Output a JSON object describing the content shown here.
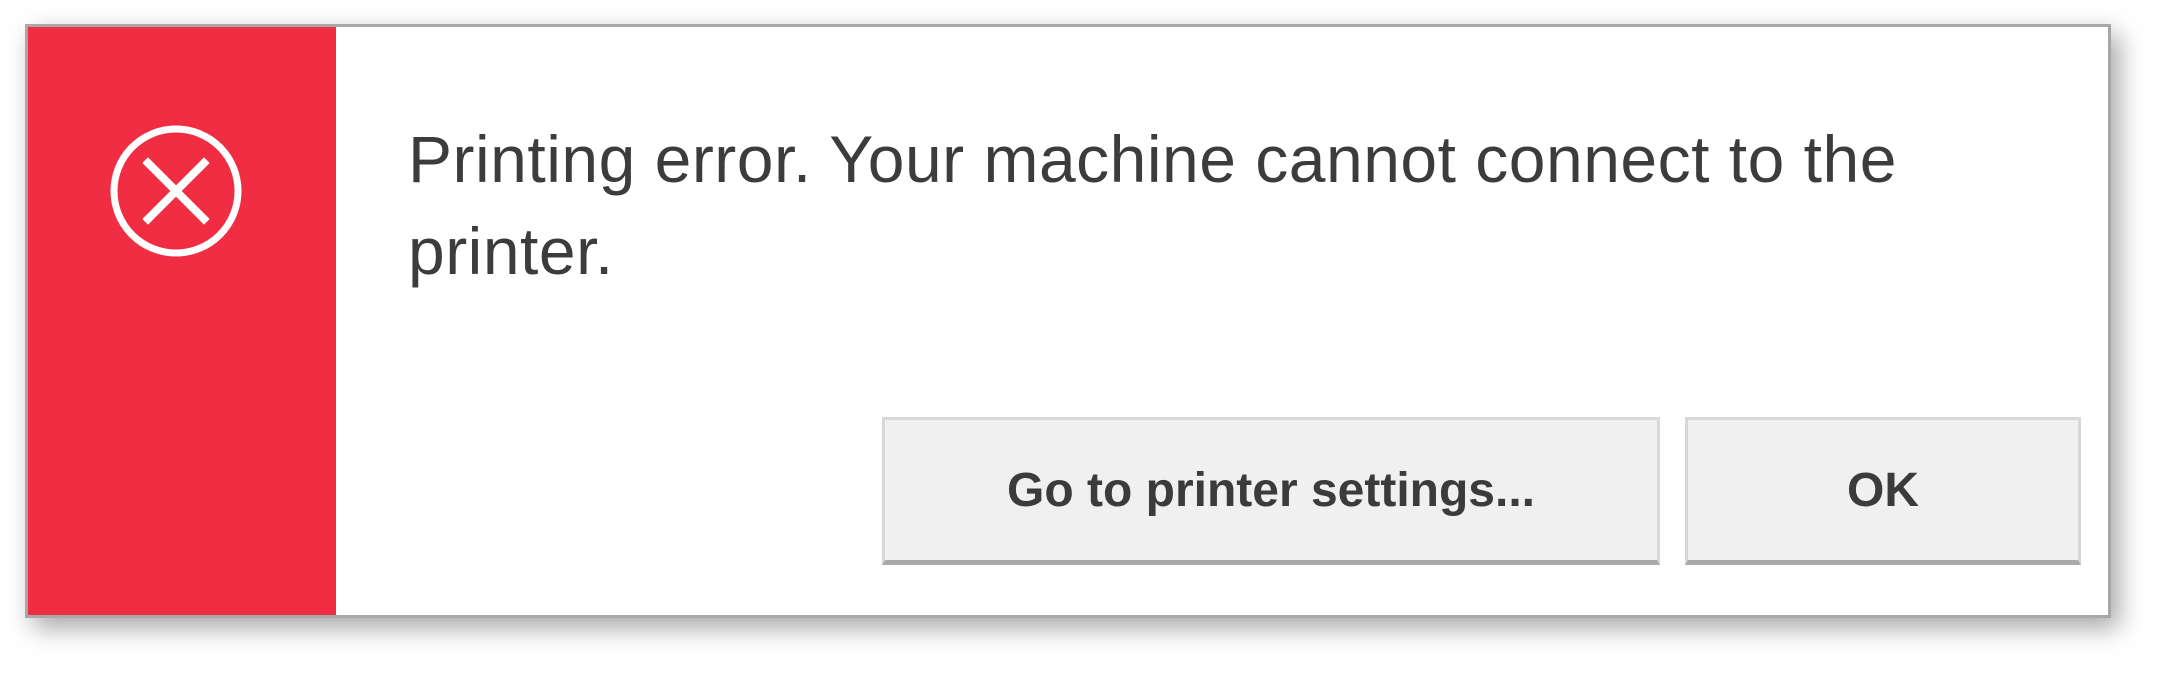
{
  "dialog": {
    "message": "Printing error. Your machine cannot connect to the printer.",
    "icon": "error-circle-x-icon",
    "accent_color": "#f02d42",
    "buttons": {
      "settings_label": "Go to printer settings...",
      "ok_label": "OK"
    }
  }
}
